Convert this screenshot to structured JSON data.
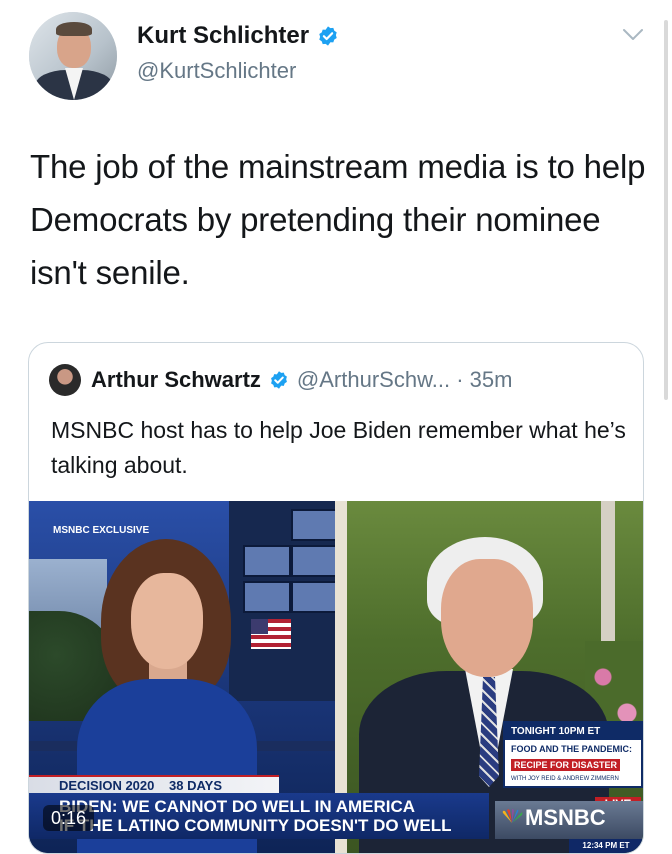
{
  "tweet": {
    "author_name": "Kurt Schlichter",
    "author_handle": "@KurtSchlichter",
    "text": "The job of the mainstream media is to help Democrats by pretending their nominee isn't senile."
  },
  "quoted_tweet": {
    "author_name": "Arthur Schwartz",
    "author_handle": "@ArthurSchw... · 35m",
    "text": "MSNBC host has to help Joe Biden remember what he’s talking about."
  },
  "video": {
    "duration": "0:16",
    "network_badge": "MSNBC EXCLUSIVE",
    "tonight_header": "TONIGHT 10PM ET",
    "tonight_line1": "FOOD AND THE PANDEMIC:",
    "tonight_line2": "RECIPE FOR DISASTER",
    "tonight_line3": "WITH JOY REID & ANDREW ZIMMERN",
    "live_label": "LIVE",
    "decision_label": "DECISION 2020",
    "days_label": "38 DAYS",
    "chyron_line1": "BIDEN: WE CANNOT DO WELL IN AMERICA",
    "chyron_line2": "IF THE LATINO COMMUNITY DOESN'T DO WELL",
    "network_logo": "MSNBC",
    "clock": "12:34 PM ET"
  },
  "colors": {
    "verified_blue": "#1da1f2",
    "text_primary": "#14171a",
    "text_secondary": "#657786",
    "msnbc_navy": "#0f2866"
  }
}
